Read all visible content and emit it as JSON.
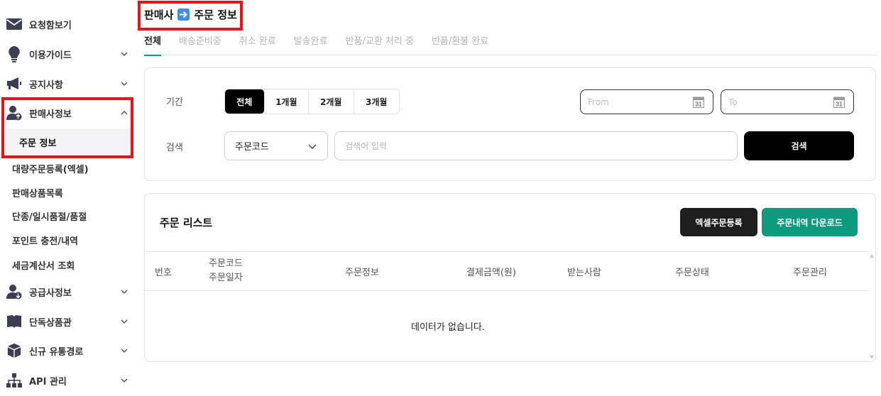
{
  "sidebar": {
    "items": [
      {
        "label": "요청함보기",
        "icon": "envelope-icon"
      },
      {
        "label": "이용가이드",
        "icon": "lightbulb-icon"
      },
      {
        "label": "공지사항",
        "icon": "megaphone-icon"
      },
      {
        "label": "판매사정보",
        "icon": "user-upload-icon"
      },
      {
        "label": "공급사정보",
        "icon": "user-download-icon"
      },
      {
        "label": "단독상품관",
        "icon": "book-icon"
      },
      {
        "label": "신규 유통경로",
        "icon": "box-icon"
      },
      {
        "label": "API 관리",
        "icon": "sitemap-icon"
      }
    ],
    "seller_sub": {
      "active": "주문 정보",
      "others": [
        "대량주문등록(엑셀)",
        "판매상품목록",
        "단종/일시품절/품절",
        "포인트 충전/내역",
        "세금계산서 조회"
      ]
    }
  },
  "header": {
    "title_left": "판매사",
    "title_right": "주문 정보"
  },
  "tabs": [
    "전체",
    "배송준비중",
    "취소 완료",
    "발송완료",
    "반품/교환 처리 중",
    "반품/환불 완료"
  ],
  "filter": {
    "period_label": "기간",
    "period_options": [
      "전체",
      "1개월",
      "2개월",
      "3개월"
    ],
    "from_placeholder": "From",
    "to_placeholder": "To",
    "calendar_day": "31",
    "search_label": "검색",
    "search_type": "주문코드",
    "search_placeholder": "검색어 입력",
    "search_button": "검색"
  },
  "list": {
    "title": "주문 리스트",
    "excel_button": "엑셀주문등록",
    "download_button": "주문내역 다운로드",
    "columns": {
      "number": "번호",
      "code": "주문코드",
      "date": "주문일자",
      "info": "주문정보",
      "amount": "결제금액(원)",
      "recipient": "받는사람",
      "status": "주문상태",
      "manage": "주문관리"
    },
    "empty_message": "데이터가 없습니다."
  },
  "colors": {
    "accent_green": "#0e9a7f",
    "highlight_red": "#e3141a",
    "arrow_blue": "#3d8fe6"
  }
}
